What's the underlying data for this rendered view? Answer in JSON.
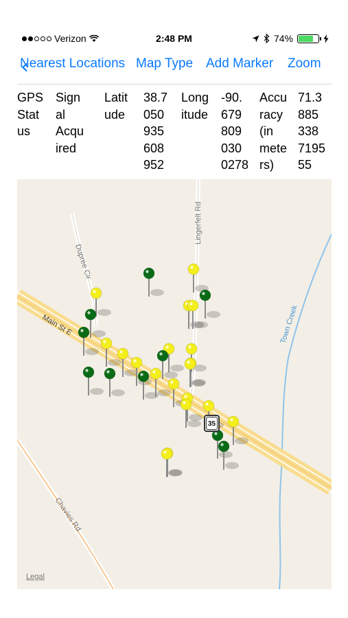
{
  "status_bar": {
    "carrier": "Verizon",
    "time": "2:48 PM",
    "battery": "74%",
    "battery_level": 0.74,
    "icons": [
      "signal-dots",
      "wifi-icon",
      "location-arrow-icon",
      "bluetooth-icon",
      "battery-icon",
      "charging-bolt-icon"
    ]
  },
  "nav": {
    "back_icon": "chevron-left-icon",
    "items": [
      "Nearest Locations",
      "Map Type",
      "Add Marker",
      "Zoom"
    ],
    "accent_color": "#0a7aff"
  },
  "info": {
    "columns": [
      "GPS\nStat\nus",
      "Sign\nal\nAcqu\nired",
      "Latit\nude",
      "38.7\n050\n935\n608\n952",
      "Long\nitude",
      "-90.\n679\n809\n030\n0278",
      "Accu\nracy\n(in\nmete\nrs)",
      "71.3\n885\n338\n7195\n55"
    ]
  },
  "map": {
    "labels": [
      "Dupree Cir",
      "Lingerfelt Rd",
      "Main St E",
      "Town Creek",
      "Chavies Rd"
    ],
    "highway_shield": "35",
    "legal": "Legal",
    "marker_colors": {
      "yellow": "#f4ee1c",
      "green": "#0a6b16"
    },
    "markers": [
      {
        "color": "green"
      },
      {
        "color": "yellow"
      },
      {
        "color": "yellow"
      },
      {
        "color": "green"
      },
      {
        "color": "yellow"
      },
      {
        "color": "yellow"
      },
      {
        "color": "green"
      },
      {
        "color": "green"
      },
      {
        "color": "yellow"
      },
      {
        "color": "green"
      },
      {
        "color": "yellow"
      },
      {
        "color": "yellow"
      },
      {
        "color": "green"
      },
      {
        "color": "yellow"
      },
      {
        "color": "yellow"
      },
      {
        "color": "green"
      },
      {
        "color": "green"
      },
      {
        "color": "yellow"
      },
      {
        "color": "yellow"
      },
      {
        "color": "yellow"
      },
      {
        "color": "yellow"
      },
      {
        "color": "yellow"
      },
      {
        "color": "yellow"
      },
      {
        "color": "yellow"
      },
      {
        "color": "yellow"
      },
      {
        "color": "green"
      },
      {
        "color": "green"
      },
      {
        "color": "yellow"
      },
      {
        "color": "yellow"
      }
    ]
  }
}
